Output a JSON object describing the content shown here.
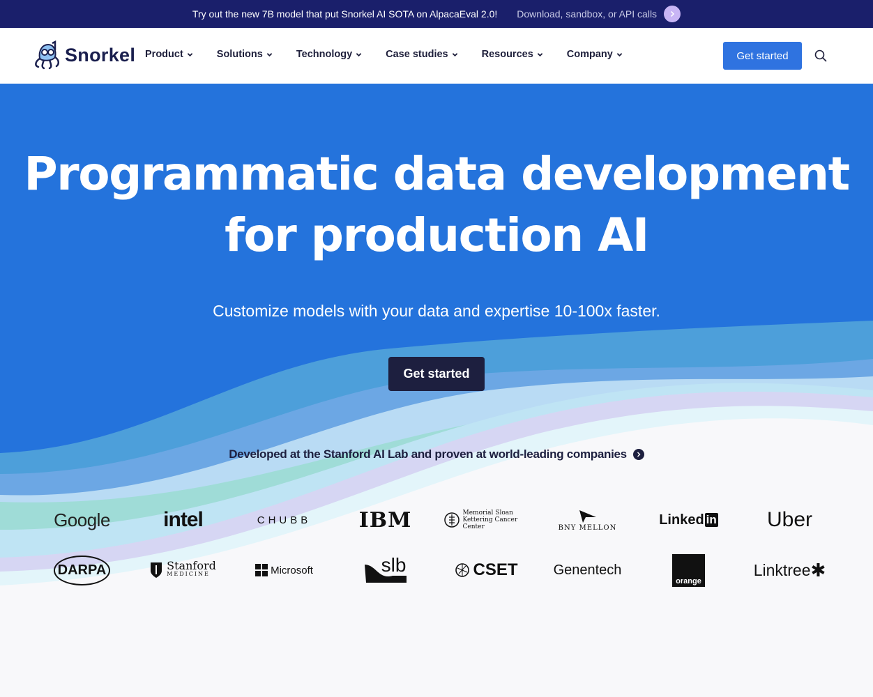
{
  "announcement": {
    "message": "Try out the new 7B model that put Snorkel AI SOTA on AlpacaEval 2.0!",
    "sub": "Download, sandbox, or API calls"
  },
  "nav": {
    "logo_text": "Snorkel",
    "items": [
      {
        "label": "Product"
      },
      {
        "label": "Solutions"
      },
      {
        "label": "Technology"
      },
      {
        "label": "Case studies"
      },
      {
        "label": "Resources"
      },
      {
        "label": "Company"
      }
    ],
    "cta": "Get started"
  },
  "hero": {
    "title_line1": "Programmatic data development",
    "title_line2": "for production AI",
    "subtitle": "Customize models with your data and expertise 10-100x faster.",
    "cta": "Get started",
    "proof": "Developed at the Stanford AI Lab and proven at world-leading companies"
  },
  "logos": {
    "row1": [
      "Google",
      "intel",
      "CHUBB",
      "IBM",
      "Memorial Sloan Kettering Cancer Center",
      "BNY MELLON",
      "Linked",
      "Uber"
    ],
    "row2": [
      "DARPA",
      "Stanford",
      "MEDICINE",
      "Microsoft",
      "slb",
      "CSET",
      "Genentech",
      "orange",
      "Linktree"
    ],
    "linkedin_in": "in"
  },
  "colors": {
    "hero_blue": "#2473dc",
    "banner": "#1a1f6b",
    "button_dark": "#1d1f3f",
    "button_blue": "#2f73e0"
  }
}
